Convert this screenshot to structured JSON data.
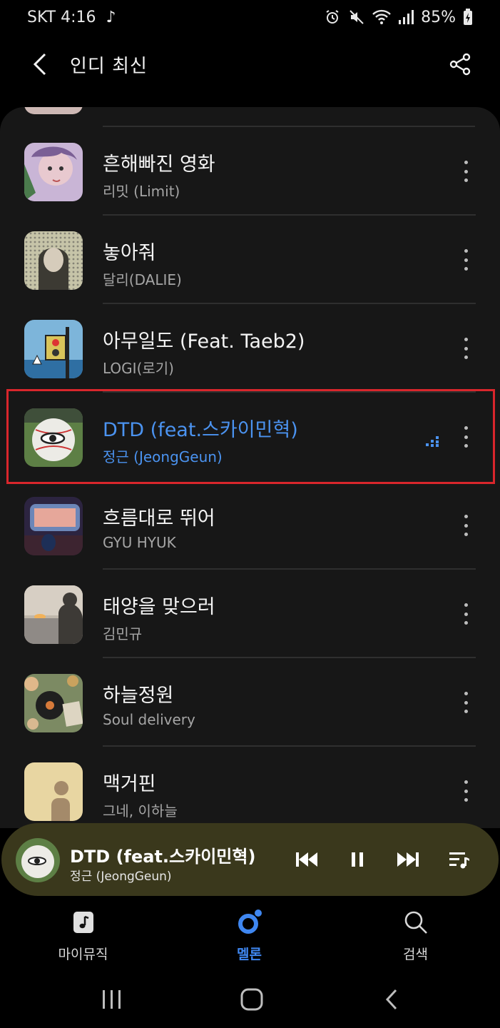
{
  "status": {
    "carrier_time": "SKT 4:16",
    "music_note": "♪",
    "battery": "85%"
  },
  "header": {
    "title": "인디 최신"
  },
  "tracks": [
    {
      "title": "흔해빠진 영화",
      "artist": "리밋 (Limit)"
    },
    {
      "title": "놓아줘",
      "artist": "달리(DALIE)"
    },
    {
      "title": "아무일도 (Feat. Taeb2)",
      "artist": "LOGI(로기)"
    },
    {
      "title": "DTD (feat.스카이민혁)",
      "artist": "정근 (JeongGeun)"
    },
    {
      "title": "흐름대로 뛰어",
      "artist": "GYU HYUK"
    },
    {
      "title": "태양을 맞으러",
      "artist": "김민규"
    },
    {
      "title": "하늘정원",
      "artist": "Soul delivery"
    },
    {
      "title": "맥거핀",
      "artist": "그네, 이하늘"
    }
  ],
  "mini_player": {
    "title": "DTD (feat.스카이민혁)",
    "artist": "정근 (JeongGeun)"
  },
  "bottom_nav": {
    "my_music": "마이뮤직",
    "melon": "멜론",
    "search": "검색"
  },
  "colors": {
    "accent": "#4b93f0",
    "highlight": "#d9262c",
    "mini_player_bg": "#3a381c"
  }
}
